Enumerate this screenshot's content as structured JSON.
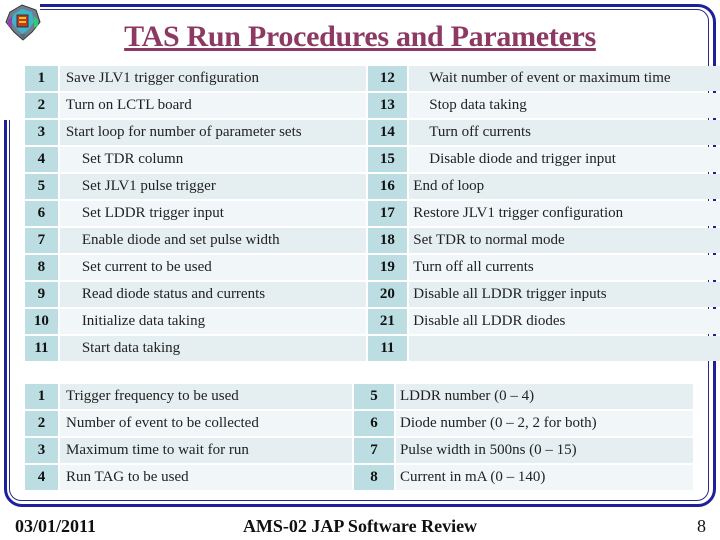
{
  "slide": {
    "title": "TAS Run Procedures and Parameters",
    "logo": "ams-detector-logo-icon"
  },
  "procedure_table": {
    "rows": [
      {
        "left_num": "1",
        "left_text": "Save JLV1 trigger configuration",
        "left_indent": false,
        "right_num": "12",
        "right_text": "Wait number of event or maximum time",
        "right_indent": true
      },
      {
        "left_num": "2",
        "left_text": "Turn on LCTL board",
        "left_indent": false,
        "right_num": "13",
        "right_text": "Stop data taking",
        "right_indent": true
      },
      {
        "left_num": "3",
        "left_text": "Start loop for number of parameter sets",
        "left_indent": false,
        "right_num": "14",
        "right_text": "Turn off currents",
        "right_indent": true
      },
      {
        "left_num": "4",
        "left_text": "Set TDR column",
        "left_indent": true,
        "right_num": "15",
        "right_text": "Disable diode and trigger input",
        "right_indent": true
      },
      {
        "left_num": "5",
        "left_text": "Set JLV1 pulse trigger",
        "left_indent": true,
        "right_num": "16",
        "right_text": "End of loop",
        "right_indent": false
      },
      {
        "left_num": "6",
        "left_text": "Set LDDR trigger input",
        "left_indent": true,
        "right_num": "17",
        "right_text": "Restore JLV1 trigger configuration",
        "right_indent": false
      },
      {
        "left_num": "7",
        "left_text": "Enable diode and set pulse width",
        "left_indent": true,
        "right_num": "18",
        "right_text": "Set TDR to normal mode",
        "right_indent": false
      },
      {
        "left_num": "8",
        "left_text": "Set current to be used",
        "left_indent": true,
        "right_num": "19",
        "right_text": "Turn off all currents",
        "right_indent": false
      },
      {
        "left_num": "9",
        "left_text": "Read diode status and currents",
        "left_indent": true,
        "right_num": "20",
        "right_text": "Disable all LDDR trigger inputs",
        "right_indent": false
      },
      {
        "left_num": "10",
        "left_text": "Initialize data taking",
        "left_indent": true,
        "right_num": "21",
        "right_text": "Disable all LDDR diodes",
        "right_indent": false
      },
      {
        "left_num": "11",
        "left_text": "Start data taking",
        "left_indent": true,
        "right_num": "11",
        "right_text": "",
        "right_indent": false
      }
    ]
  },
  "parameter_table": {
    "rows": [
      {
        "left_num": "1",
        "left_text": "Trigger frequency to be used",
        "right_num": "5",
        "right_text": "LDDR number (0 – 4)"
      },
      {
        "left_num": "2",
        "left_text": "Number of event to be collected",
        "right_num": "6",
        "right_text": "Diode number (0 – 2, 2 for both)"
      },
      {
        "left_num": "3",
        "left_text": "Maximum time to wait for run",
        "right_num": "7",
        "right_text": "Pulse width in 500ns (0 – 15)"
      },
      {
        "left_num": "4",
        "left_text": "Run TAG to be used",
        "right_num": "8",
        "right_text": "Current in mA (0 – 140)"
      }
    ]
  },
  "footer": {
    "date": "03/01/2011",
    "center": "AMS-02 JAP Software Review",
    "page": "8"
  },
  "colors": {
    "title": "#8c3a63",
    "frame": "#1f1f9e",
    "num_cell": "#bcdde2",
    "row_odd": "#e5eff1",
    "row_even": "#f1f6f8"
  }
}
